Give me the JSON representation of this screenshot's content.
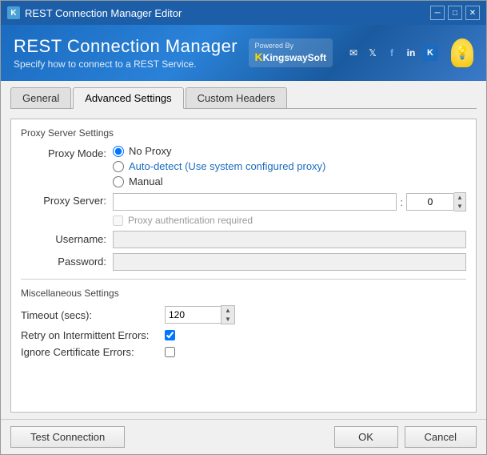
{
  "window": {
    "title": "REST Connection Manager Editor",
    "icon": "K"
  },
  "header": {
    "title": "REST Connection Manager",
    "subtitle": "Specify how to connect to a REST Service.",
    "brand": "Powered By",
    "brand_name": "KingswaySoft"
  },
  "tabs": [
    {
      "id": "general",
      "label": "General",
      "active": false
    },
    {
      "id": "advanced",
      "label": "Advanced Settings",
      "active": true
    },
    {
      "id": "custom-headers",
      "label": "Custom Headers",
      "active": false
    }
  ],
  "proxy_section": {
    "title": "Proxy Server Settings",
    "proxy_mode_label": "Proxy Mode:",
    "options": [
      {
        "id": "no-proxy",
        "label": "No Proxy",
        "checked": true
      },
      {
        "id": "auto-detect",
        "label": "Auto-detect (Use system configured proxy)",
        "checked": false
      },
      {
        "id": "manual",
        "label": "Manual",
        "checked": false
      }
    ],
    "proxy_server_label": "Proxy Server:",
    "proxy_server_value": "",
    "proxy_port_value": "0",
    "auth_label": "Proxy authentication required",
    "username_label": "Username:",
    "password_label": "Password:"
  },
  "misc_section": {
    "title": "Miscellaneous Settings",
    "timeout_label": "Timeout (secs):",
    "timeout_value": "120",
    "retry_label": "Retry on Intermittent Errors:",
    "retry_checked": true,
    "ignore_cert_label": "Ignore Certificate Errors:",
    "ignore_cert_checked": false
  },
  "footer": {
    "test_connection": "Test Connection",
    "ok": "OK",
    "cancel": "Cancel"
  }
}
